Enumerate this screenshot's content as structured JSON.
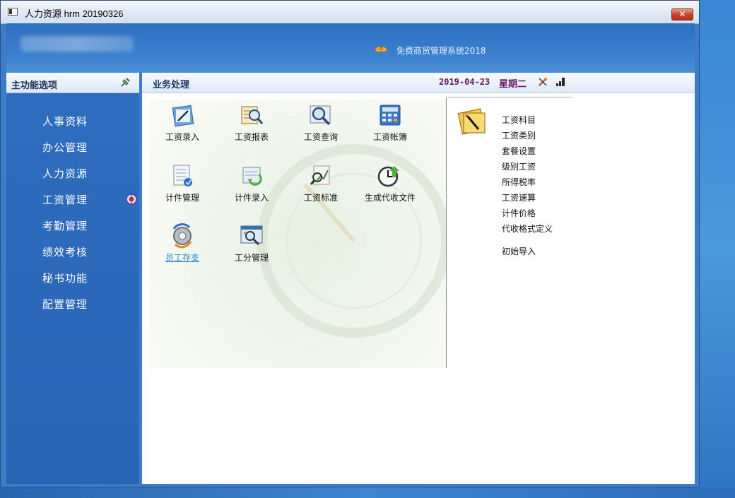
{
  "window": {
    "title": "人力资源 hrm 20190326",
    "close_label": "✕"
  },
  "header": {
    "brand_text": "免费商贸管理系统2018"
  },
  "sidebar": {
    "title": "主功能选项",
    "items": [
      {
        "label": "人事资料"
      },
      {
        "label": "办公管理"
      },
      {
        "label": "人力资源"
      },
      {
        "label": "工资管理",
        "active": true
      },
      {
        "label": "考勤管理"
      },
      {
        "label": "绩效考核"
      },
      {
        "label": "秘书功能"
      },
      {
        "label": "配置管理"
      }
    ]
  },
  "main": {
    "title": "业务处理",
    "date": "2019-04-23",
    "weekday": "星期二",
    "tiles": [
      {
        "label": "工资录入",
        "icon": "salary-entry-icon"
      },
      {
        "label": "工资报表",
        "icon": "salary-report-icon"
      },
      {
        "label": "工资查询",
        "icon": "salary-query-icon"
      },
      {
        "label": "工资帐簿",
        "icon": "salary-ledger-icon"
      },
      {
        "label": "计件管理",
        "icon": "piecework-manage-icon"
      },
      {
        "label": "计件录入",
        "icon": "piecework-entry-icon"
      },
      {
        "label": "工资标准",
        "icon": "salary-standard-icon"
      },
      {
        "label": "生成代收文件",
        "icon": "generate-file-icon"
      },
      {
        "label": "员工存支",
        "icon": "employee-deposit-icon"
      },
      {
        "label": "工分管理",
        "icon": "workpoint-manage-icon"
      }
    ],
    "links": [
      {
        "label": "工资科目"
      },
      {
        "label": "工资类别"
      },
      {
        "label": "套餐设置"
      },
      {
        "label": "级别工资"
      },
      {
        "label": "所得税率"
      },
      {
        "label": "工资速算"
      },
      {
        "label": "计件价格"
      },
      {
        "label": "代收格式定义"
      },
      {
        "label": "初始导入"
      }
    ]
  },
  "colors": {
    "sidebar_bg": "#2f6dbf",
    "date_color": "#6b1460",
    "link_color": "#1e8fc9"
  }
}
